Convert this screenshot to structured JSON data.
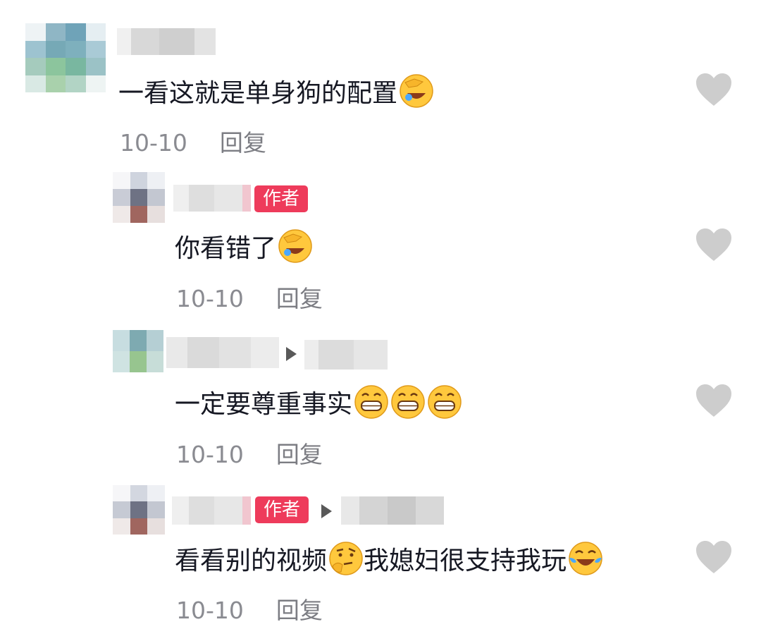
{
  "colors": {
    "text": "#161823",
    "meta": "#8a8b91",
    "author_badge": "#ee3b5b",
    "heart": "#cfcfcf"
  },
  "comments": [
    {
      "text": "一看这就是单身狗的配置",
      "emojis": [
        "facepalm-laughing-emoji"
      ],
      "date": "10-10",
      "reply_label": "回复",
      "author_badge": null
    },
    {
      "text": "你看错了",
      "emojis": [
        "facepalm-laughing-emoji"
      ],
      "date": "10-10",
      "reply_label": "回复",
      "author_badge": "作者"
    },
    {
      "text": "一定要尊重事实",
      "emojis": [
        "grinning-emoji",
        "grinning-emoji",
        "grinning-emoji"
      ],
      "date": "10-10",
      "reply_label": "回复",
      "author_badge": null
    },
    {
      "text": "看看别的视频",
      "text2": "我媳妇很支持我玩",
      "emojis": [
        "thinking-emoji",
        "crying-laughing-emoji"
      ],
      "date": "10-10",
      "reply_label": "回复",
      "author_badge": "作者"
    }
  ]
}
